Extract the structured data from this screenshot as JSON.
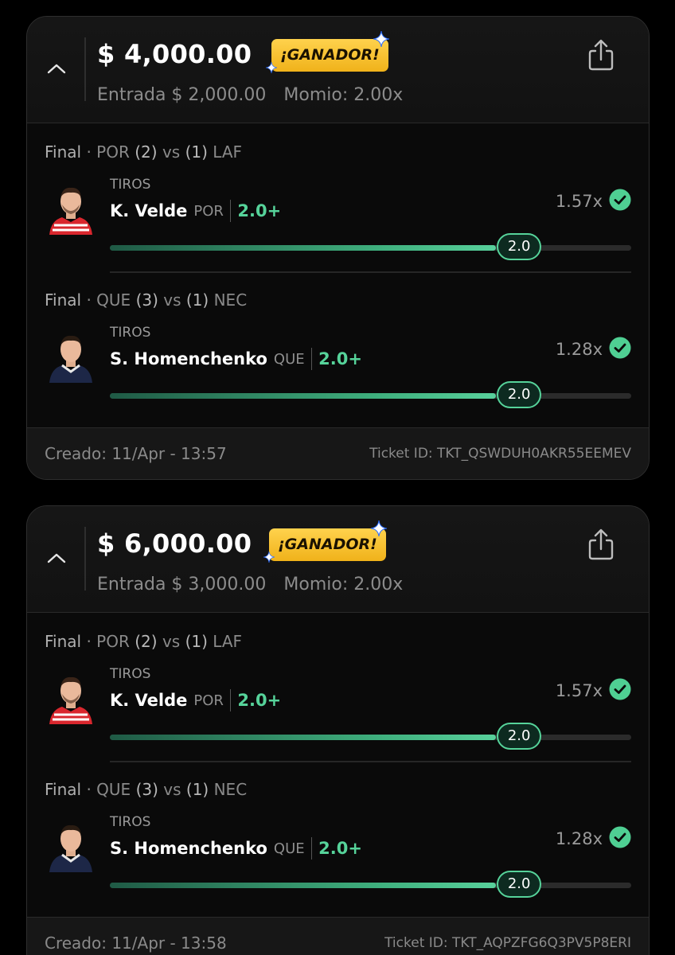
{
  "colors": {
    "accent_green": "#56d39a",
    "badge_gold": "#f5bf2a",
    "background": "#000000"
  },
  "tickets": [
    {
      "payout": "$ 4,000.00",
      "badge": "¡GANADOR!",
      "entry": "Entrada $ 2,000.00",
      "momio": "Momio: 2.00x",
      "legs": [
        {
          "status": "Final",
          "dot": "·",
          "team_a": "POR",
          "score_a": "(2)",
          "vs": "vs",
          "score_b": "(1)",
          "team_b": "LAF",
          "stat": "TIROS",
          "player": "K. Velde",
          "team": "POR",
          "line": "2.0+",
          "multiplier": "1.57x",
          "result": "2.0",
          "progress": 0.74,
          "kit": "red",
          "icon": "check-circle-icon"
        },
        {
          "status": "Final",
          "dot": "·",
          "team_a": "QUE",
          "score_a": "(3)",
          "vs": "vs",
          "score_b": "(1)",
          "team_b": "NEC",
          "stat": "TIROS",
          "player": "S. Homenchenko",
          "team": "QUE",
          "line": "2.0+",
          "multiplier": "1.28x",
          "result": "2.0",
          "progress": 0.74,
          "kit": "navy",
          "icon": "check-circle-icon"
        }
      ],
      "created": "Creado: 11/Apr - 13:57",
      "ticket_id": "Ticket ID: TKT_QSWDUH0AKR55EEMEV"
    },
    {
      "payout": "$ 6,000.00",
      "badge": "¡GANADOR!",
      "entry": "Entrada $ 3,000.00",
      "momio": "Momio: 2.00x",
      "legs": [
        {
          "status": "Final",
          "dot": "·",
          "team_a": "POR",
          "score_a": "(2)",
          "vs": "vs",
          "score_b": "(1)",
          "team_b": "LAF",
          "stat": "TIROS",
          "player": "K. Velde",
          "team": "POR",
          "line": "2.0+",
          "multiplier": "1.57x",
          "result": "2.0",
          "progress": 0.74,
          "kit": "red",
          "icon": "check-circle-icon"
        },
        {
          "status": "Final",
          "dot": "·",
          "team_a": "QUE",
          "score_a": "(3)",
          "vs": "vs",
          "score_b": "(1)",
          "team_b": "NEC",
          "stat": "TIROS",
          "player": "S. Homenchenko",
          "team": "QUE",
          "line": "2.0+",
          "multiplier": "1.28x",
          "result": "2.0",
          "progress": 0.74,
          "kit": "navy",
          "icon": "check-circle-icon"
        }
      ],
      "created": "Creado: 11/Apr - 13:58",
      "ticket_id": "Ticket ID: TKT_AQPZFG6Q3PV5P8ERI"
    }
  ]
}
